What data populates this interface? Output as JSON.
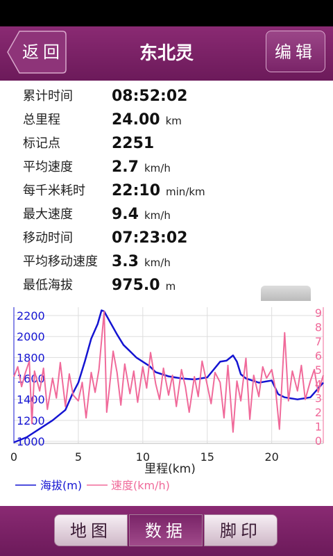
{
  "header": {
    "back_label": "返回",
    "title": "东北灵",
    "edit_label": "编辑"
  },
  "stats": [
    {
      "label": "累计时间",
      "value": "08:52:02",
      "unit": ""
    },
    {
      "label": "总里程",
      "value": "24.00",
      "unit": "km"
    },
    {
      "label": "标记点",
      "value": "2251",
      "unit": ""
    },
    {
      "label": "平均速度",
      "value": "2.7",
      "unit": "km/h"
    },
    {
      "label": "每千米耗时",
      "value": "22:10",
      "unit": "min/km"
    },
    {
      "label": "最大速度",
      "value": "9.4",
      "unit": "km/h"
    },
    {
      "label": "移动时间",
      "value": "07:23:02",
      "unit": ""
    },
    {
      "label": "平均移动速度",
      "value": "3.3",
      "unit": "km/h"
    },
    {
      "label": "最低海拔",
      "value": "975.0",
      "unit": "m"
    }
  ],
  "chart_data": {
    "type": "line",
    "xlabel": "里程(km)",
    "xlim": [
      0,
      24
    ],
    "x_ticks": [
      0,
      5,
      10,
      15,
      20
    ],
    "y_left_ticks": [
      1000,
      1200,
      1400,
      1600,
      1800,
      2000,
      2200
    ],
    "y_left_lim": [
      980,
      2280
    ],
    "y_right_ticks": [
      0,
      1,
      2,
      3,
      4,
      5,
      6,
      7,
      8,
      9
    ],
    "y_right_lim": [
      -0.2,
      9.4
    ],
    "legend_position": "bottom-left",
    "series": [
      {
        "name": "海拔(m)",
        "color": "#1414d2",
        "axis": "left",
        "x": [
          0,
          1,
          2,
          3,
          4,
          4.5,
          5,
          5.5,
          6,
          6.5,
          6.8,
          7,
          7.5,
          8,
          8.5,
          9,
          9.5,
          10,
          10.5,
          11,
          11.5,
          12,
          13,
          14,
          15,
          16,
          16.5,
          17,
          17.3,
          17.6,
          18,
          19,
          20,
          20.5,
          21,
          22,
          23,
          24
        ],
        "y": [
          990,
          1040,
          1120,
          1200,
          1300,
          1440,
          1560,
          1760,
          1980,
          2120,
          2250,
          2240,
          2130,
          2020,
          1920,
          1860,
          1800,
          1760,
          1720,
          1660,
          1640,
          1620,
          1600,
          1590,
          1610,
          1760,
          1770,
          1820,
          1760,
          1640,
          1600,
          1560,
          1580,
          1450,
          1420,
          1400,
          1420,
          1560
        ]
      },
      {
        "name": "速度(km/h)",
        "color": "#f06a9a",
        "axis": "right",
        "x": [
          0,
          0.3,
          0.6,
          0.9,
          1.2,
          1.4,
          1.6,
          2,
          2.3,
          2.6,
          3,
          3.3,
          3.6,
          4,
          4.3,
          4.6,
          5,
          5.3,
          5.6,
          6,
          6.3,
          6.6,
          7,
          7.2,
          7.4,
          7.7,
          8,
          8.3,
          8.6,
          9,
          9.3,
          9.6,
          10,
          10.3,
          10.6,
          11,
          11.3,
          11.6,
          12,
          12.3,
          12.6,
          13,
          13.3,
          13.6,
          14,
          14.3,
          14.6,
          15,
          15.3,
          15.6,
          16,
          16.3,
          16.6,
          17,
          17.3,
          17.6,
          18,
          18.3,
          18.6,
          19,
          19.3,
          19.6,
          20,
          20.3,
          20.6,
          21,
          21.3,
          21.6,
          22,
          22.3,
          22.6,
          23,
          23.3,
          23.6,
          24
        ],
        "y": [
          4.5,
          5.2,
          3.8,
          4.8,
          5.6,
          1.2,
          4.9,
          3.5,
          5.1,
          2.2,
          4.4,
          3.0,
          5.5,
          2.4,
          4.7,
          3.2,
          2.8,
          4.1,
          1.6,
          4.8,
          3.4,
          5.0,
          9.1,
          2.0,
          3.6,
          6.3,
          4.8,
          2.5,
          5.4,
          3.3,
          4.9,
          2.7,
          5.2,
          3.7,
          6.2,
          4.0,
          2.9,
          5.1,
          3.2,
          4.6,
          2.4,
          5.0,
          3.8,
          2.0,
          4.5,
          3.1,
          5.6,
          3.9,
          2.6,
          4.8,
          4.1,
          1.6,
          5.3,
          0.6,
          4.2,
          2.8,
          5.8,
          1.5,
          4.6,
          3.1,
          5.2,
          4.4,
          5.0,
          3.6,
          0.8,
          7.6,
          2.8,
          4.9,
          3.5,
          5.3,
          2.9,
          4.2,
          5.0,
          3.4,
          4.6
        ]
      }
    ]
  },
  "tabs": [
    {
      "label": "地图",
      "active": false
    },
    {
      "label": "数据",
      "active": true
    },
    {
      "label": "脚印",
      "active": false
    }
  ]
}
